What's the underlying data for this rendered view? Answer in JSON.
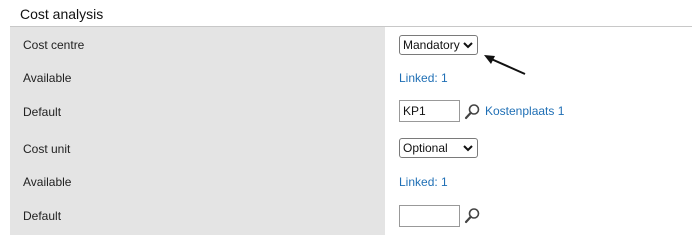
{
  "section": {
    "title": "Cost analysis"
  },
  "rows": {
    "cost_centre": {
      "label": "Cost centre",
      "value": "Mandatory"
    },
    "available_1": {
      "label": "Available",
      "link": "Linked: 1"
    },
    "default_1": {
      "label": "Default",
      "code": "KP1",
      "name_link": "Kostenplaats 1"
    },
    "cost_unit": {
      "label": "Cost unit",
      "value": "Optional"
    },
    "available_2": {
      "label": "Available",
      "link": "Linked: 1"
    },
    "default_2": {
      "label": "Default",
      "code": ""
    }
  },
  "icons": {
    "select_chevron": "chevron-down-icon",
    "lookup": "magnifier-icon",
    "annotation": "arrow-icon"
  },
  "colors": {
    "label_background": "#e4e4e4",
    "link": "#1f6fb5"
  }
}
